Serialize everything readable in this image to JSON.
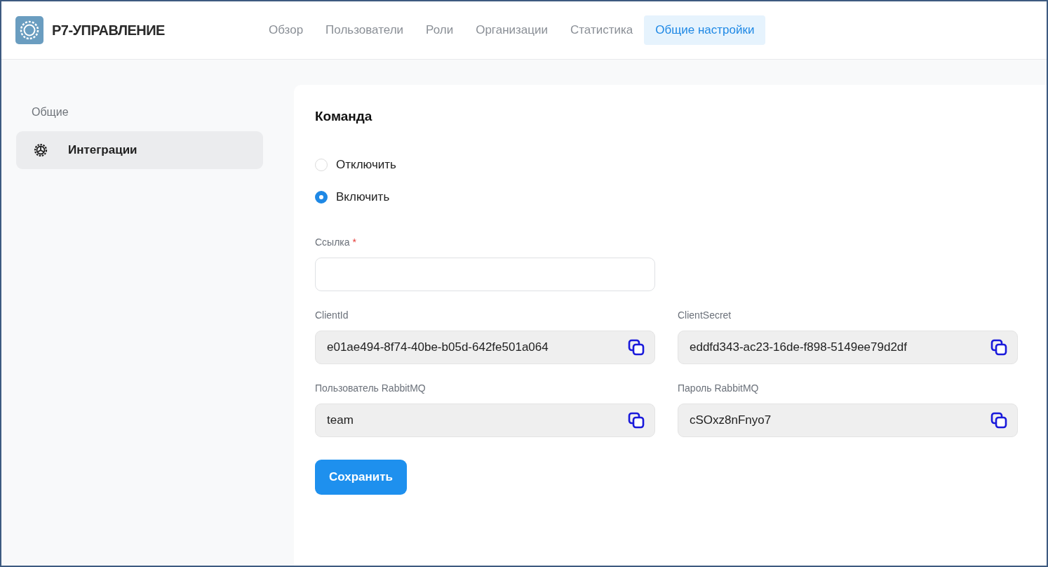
{
  "app": {
    "name": "Р7-УПРАВЛЕНИЕ"
  },
  "nav": [
    {
      "label": "Обзор",
      "selected": false
    },
    {
      "label": "Пользователи",
      "selected": false
    },
    {
      "label": "Роли",
      "selected": false
    },
    {
      "label": "Организации",
      "selected": false
    },
    {
      "label": "Статистика",
      "selected": false
    },
    {
      "label": "Общие настройки",
      "selected": true
    }
  ],
  "sidebar": {
    "group": "Общие",
    "items": [
      {
        "label": "Интеграции",
        "selected": true
      }
    ]
  },
  "section": {
    "title": "Команда",
    "options": [
      {
        "label": "Отключить",
        "selected": false
      },
      {
        "label": "Включить",
        "selected": true
      }
    ],
    "link_field": {
      "label": "Ссылка",
      "required_mark": "*"
    },
    "fields": [
      {
        "label": "ClientId",
        "value": "e01ae494-8f74-40be-b05d-642fe501a064"
      },
      {
        "label": "ClientSecret",
        "value": "eddfd343-ac23-16de-f898-5149ee79d2df"
      },
      {
        "label": "Пользователь RabbitMQ",
        "value": "team"
      },
      {
        "label": "Пароль RabbitMQ",
        "value": "cSOxz8nFnyo7"
      }
    ],
    "save_button": "Сохранить"
  }
}
